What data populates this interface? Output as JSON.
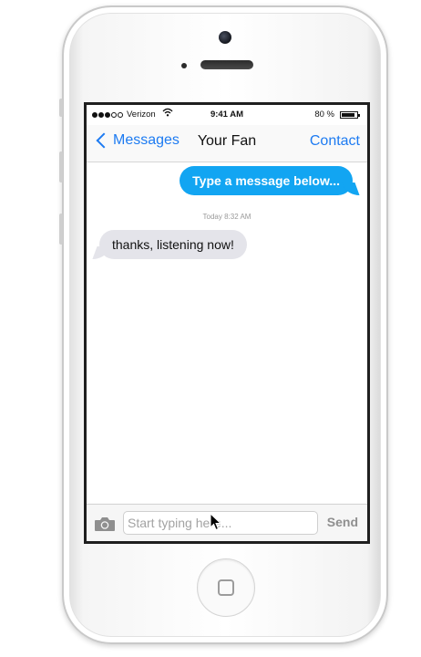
{
  "status_bar": {
    "carrier": "Verizon",
    "time": "9:41 AM",
    "battery_percent": "80 %",
    "battery_level": 0.8,
    "signal_bars_filled": 3,
    "signal_bars_total": 5
  },
  "nav": {
    "back_label": "Messages",
    "title": "Your Fan",
    "right_label": "Contact"
  },
  "messages": [
    {
      "direction": "outgoing",
      "text": "Type a message below..."
    },
    {
      "direction": "incoming",
      "text": "thanks, listening now!"
    }
  ],
  "timestamp": "Today 8:32 AM",
  "composer": {
    "placeholder": "Start typing here...",
    "value": "",
    "send_label": "Send"
  },
  "colors": {
    "accent_blue": "#1d7bf2",
    "outgoing_bubble": "#12a5f2",
    "incoming_bubble": "#e4e4ea"
  },
  "icons": [
    "camera-icon",
    "chevron-left-icon",
    "wifi-icon",
    "battery-icon",
    "signal-icon",
    "mouse-cursor-icon"
  ]
}
